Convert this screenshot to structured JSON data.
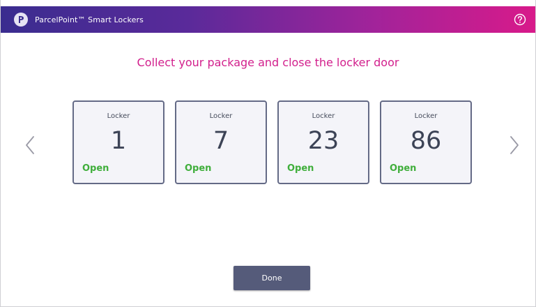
{
  "header": {
    "title": "ParcelPoint™ Smart Lockers",
    "logo_icon": "parcelpoint-logo-icon",
    "help_icon": "help-circle-icon"
  },
  "instruction": "Collect your package and close the locker door",
  "navigation": {
    "prev_icon": "chevron-left-icon",
    "next_icon": "chevron-right-icon"
  },
  "lockers": [
    {
      "label": "Locker",
      "number": "1",
      "status": "Open"
    },
    {
      "label": "Locker",
      "number": "7",
      "status": "Open"
    },
    {
      "label": "Locker",
      "number": "23",
      "status": "Open"
    },
    {
      "label": "Locker",
      "number": "86",
      "status": "Open"
    }
  ],
  "done_button": {
    "label": "Done"
  },
  "colors": {
    "accent_pink": "#d21f8c",
    "status_open": "#3fae3b",
    "button": "#555b7a",
    "header_start": "#3a2c8f",
    "header_end": "#d81a8a"
  }
}
